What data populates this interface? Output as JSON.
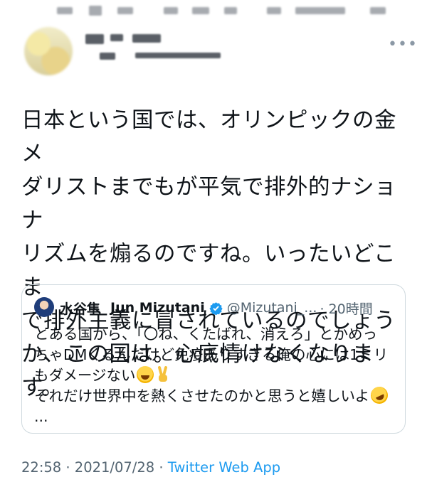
{
  "tweet": {
    "text": "日本という国では、オリンピックの金メ\nダリストまでもが平気で排外的ナショナ\nリズムを煽るのですね。いったいどこま\nで排外主義に冒されているのでしょう\nか、この国は。心底情けなくなります。"
  },
  "quoted_tweet": {
    "display_name": "水谷隼",
    "display_name_en": "Jun Mizutani",
    "handle": "@Mizutani_...",
    "time": "· 20時間",
    "line1": "とある国から、「〇ね、くたばれ、消えろ」とかめっ",
    "line2": "ちゃDMくるんだけど免疫ありすぎる俺の心には1ミリ",
    "line3": "もダメージない",
    "line4": "それだけ世界中を熱くさせたのかと思うと嬉しいよ",
    "line5": "...",
    "colors": {
      "verified": "#1d9bf0",
      "secondary": "#536471"
    }
  },
  "meta": {
    "timestamp": "22:58 · 2021/07/28 · ",
    "source": "Twitter Web App"
  },
  "icons": [
    "more-icon",
    "verified-badge-icon",
    "laughing-emoji-icon",
    "peace-emoji-icon",
    "rofl-emoji-icon"
  ]
}
